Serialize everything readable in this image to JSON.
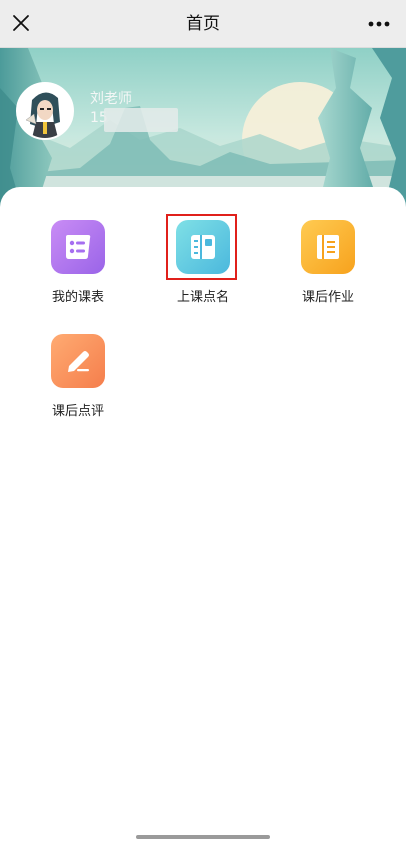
{
  "titlebar": {
    "title": "首页",
    "close_icon": "close-icon",
    "more_icon": "more-icon"
  },
  "profile": {
    "name": "刘老师",
    "phone_visible": "15",
    "avatar_icon": "avatar"
  },
  "menu": {
    "items": [
      {
        "label": "我的课表",
        "icon": "schedule-icon",
        "color_from": "#c98cf5",
        "color_to": "#9a64e8"
      },
      {
        "label": "上课点名",
        "icon": "roll-call-icon",
        "color_from": "#7fe0e6",
        "color_to": "#4bb8dd"
      },
      {
        "label": "课后作业",
        "icon": "homework-icon",
        "color_from": "#ffcb52",
        "color_to": "#f7a21d"
      },
      {
        "label": "课后点评",
        "icon": "review-icon",
        "color_from": "#ffab72",
        "color_to": "#f57e4c"
      }
    ]
  },
  "highlight_color": "#e0201b"
}
